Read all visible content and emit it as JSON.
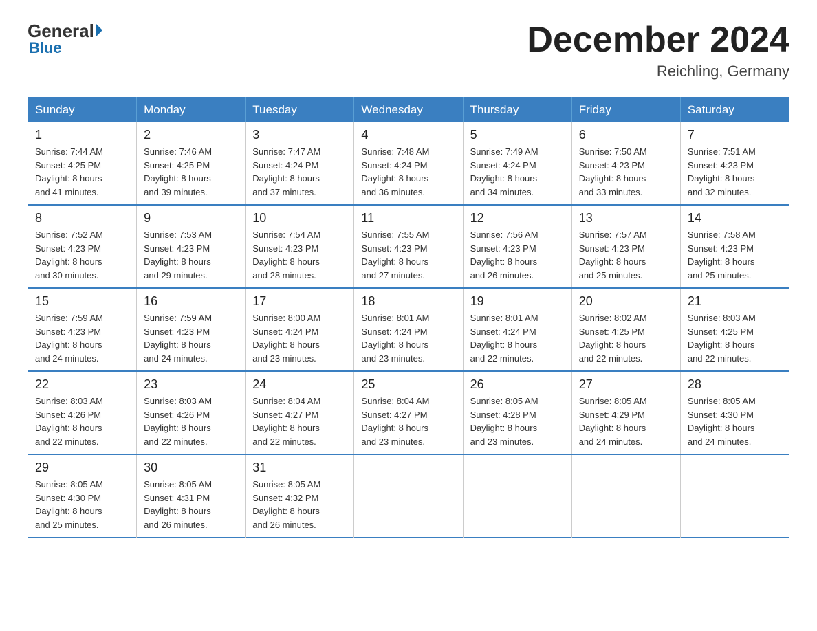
{
  "header": {
    "logo": {
      "general": "General",
      "blue": "Blue",
      "tagline": "Blue"
    },
    "title": "December 2024",
    "location": "Reichling, Germany"
  },
  "weekdays": [
    "Sunday",
    "Monday",
    "Tuesday",
    "Wednesday",
    "Thursday",
    "Friday",
    "Saturday"
  ],
  "weeks": [
    [
      {
        "day": "1",
        "sunrise": "7:44 AM",
        "sunset": "4:25 PM",
        "daylight": "8 hours and 41 minutes."
      },
      {
        "day": "2",
        "sunrise": "7:46 AM",
        "sunset": "4:25 PM",
        "daylight": "8 hours and 39 minutes."
      },
      {
        "day": "3",
        "sunrise": "7:47 AM",
        "sunset": "4:24 PM",
        "daylight": "8 hours and 37 minutes."
      },
      {
        "day": "4",
        "sunrise": "7:48 AM",
        "sunset": "4:24 PM",
        "daylight": "8 hours and 36 minutes."
      },
      {
        "day": "5",
        "sunrise": "7:49 AM",
        "sunset": "4:24 PM",
        "daylight": "8 hours and 34 minutes."
      },
      {
        "day": "6",
        "sunrise": "7:50 AM",
        "sunset": "4:23 PM",
        "daylight": "8 hours and 33 minutes."
      },
      {
        "day": "7",
        "sunrise": "7:51 AM",
        "sunset": "4:23 PM",
        "daylight": "8 hours and 32 minutes."
      }
    ],
    [
      {
        "day": "8",
        "sunrise": "7:52 AM",
        "sunset": "4:23 PM",
        "daylight": "8 hours and 30 minutes."
      },
      {
        "day": "9",
        "sunrise": "7:53 AM",
        "sunset": "4:23 PM",
        "daylight": "8 hours and 29 minutes."
      },
      {
        "day": "10",
        "sunrise": "7:54 AM",
        "sunset": "4:23 PM",
        "daylight": "8 hours and 28 minutes."
      },
      {
        "day": "11",
        "sunrise": "7:55 AM",
        "sunset": "4:23 PM",
        "daylight": "8 hours and 27 minutes."
      },
      {
        "day": "12",
        "sunrise": "7:56 AM",
        "sunset": "4:23 PM",
        "daylight": "8 hours and 26 minutes."
      },
      {
        "day": "13",
        "sunrise": "7:57 AM",
        "sunset": "4:23 PM",
        "daylight": "8 hours and 25 minutes."
      },
      {
        "day": "14",
        "sunrise": "7:58 AM",
        "sunset": "4:23 PM",
        "daylight": "8 hours and 25 minutes."
      }
    ],
    [
      {
        "day": "15",
        "sunrise": "7:59 AM",
        "sunset": "4:23 PM",
        "daylight": "8 hours and 24 minutes."
      },
      {
        "day": "16",
        "sunrise": "7:59 AM",
        "sunset": "4:23 PM",
        "daylight": "8 hours and 24 minutes."
      },
      {
        "day": "17",
        "sunrise": "8:00 AM",
        "sunset": "4:24 PM",
        "daylight": "8 hours and 23 minutes."
      },
      {
        "day": "18",
        "sunrise": "8:01 AM",
        "sunset": "4:24 PM",
        "daylight": "8 hours and 23 minutes."
      },
      {
        "day": "19",
        "sunrise": "8:01 AM",
        "sunset": "4:24 PM",
        "daylight": "8 hours and 22 minutes."
      },
      {
        "day": "20",
        "sunrise": "8:02 AM",
        "sunset": "4:25 PM",
        "daylight": "8 hours and 22 minutes."
      },
      {
        "day": "21",
        "sunrise": "8:03 AM",
        "sunset": "4:25 PM",
        "daylight": "8 hours and 22 minutes."
      }
    ],
    [
      {
        "day": "22",
        "sunrise": "8:03 AM",
        "sunset": "4:26 PM",
        "daylight": "8 hours and 22 minutes."
      },
      {
        "day": "23",
        "sunrise": "8:03 AM",
        "sunset": "4:26 PM",
        "daylight": "8 hours and 22 minutes."
      },
      {
        "day": "24",
        "sunrise": "8:04 AM",
        "sunset": "4:27 PM",
        "daylight": "8 hours and 22 minutes."
      },
      {
        "day": "25",
        "sunrise": "8:04 AM",
        "sunset": "4:27 PM",
        "daylight": "8 hours and 23 minutes."
      },
      {
        "day": "26",
        "sunrise": "8:05 AM",
        "sunset": "4:28 PM",
        "daylight": "8 hours and 23 minutes."
      },
      {
        "day": "27",
        "sunrise": "8:05 AM",
        "sunset": "4:29 PM",
        "daylight": "8 hours and 24 minutes."
      },
      {
        "day": "28",
        "sunrise": "8:05 AM",
        "sunset": "4:30 PM",
        "daylight": "8 hours and 24 minutes."
      }
    ],
    [
      {
        "day": "29",
        "sunrise": "8:05 AM",
        "sunset": "4:30 PM",
        "daylight": "8 hours and 25 minutes."
      },
      {
        "day": "30",
        "sunrise": "8:05 AM",
        "sunset": "4:31 PM",
        "daylight": "8 hours and 26 minutes."
      },
      {
        "day": "31",
        "sunrise": "8:05 AM",
        "sunset": "4:32 PM",
        "daylight": "8 hours and 26 minutes."
      },
      null,
      null,
      null,
      null
    ]
  ]
}
